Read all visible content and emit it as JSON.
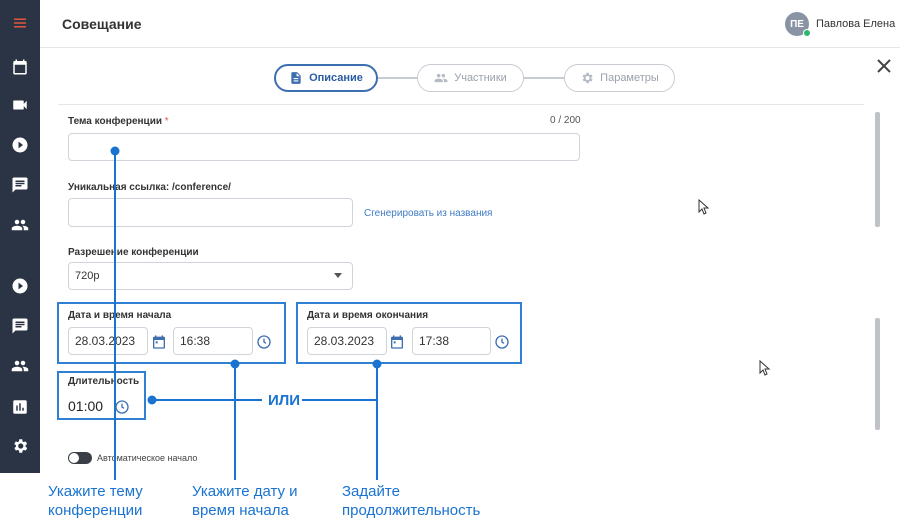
{
  "header": {
    "title": "Совещание",
    "user": {
      "initials": "ПЕ",
      "name": "Павлова Елена"
    }
  },
  "sidebar": {
    "items": [
      {
        "icon": "menu-icon"
      },
      {
        "icon": "calendar-icon"
      },
      {
        "icon": "video-camera-icon"
      },
      {
        "icon": "play-circle-icon"
      },
      {
        "icon": "chat-icon"
      },
      {
        "icon": "people-icon"
      },
      {
        "icon": "play-circle-icon"
      },
      {
        "icon": "chat-icon"
      },
      {
        "icon": "people-icon"
      },
      {
        "icon": "bar-chart-icon"
      },
      {
        "icon": "gear-icon"
      }
    ]
  },
  "stepper": {
    "steps": [
      {
        "label": "Описание",
        "icon": "document-icon",
        "active": true
      },
      {
        "label": "Участники",
        "icon": "people-icon",
        "active": false
      },
      {
        "label": "Параметры",
        "icon": "gear-icon",
        "active": false
      }
    ]
  },
  "form": {
    "topic_label": "Тема конференции",
    "required_mark": "*",
    "topic_counter": "0 / 200",
    "topic_value": "",
    "link_label": "Уникальная ссылка: /conference/",
    "link_value": "",
    "generate_link": "Сгенерировать из названия",
    "resolution_label": "Разрешение конференции",
    "resolution_value": "720p",
    "start_label": "Дата и время начала",
    "start_date": "28.03.2023",
    "start_time": "16:38",
    "end_label": "Дата и время окончания",
    "end_date": "28.03.2023",
    "end_time": "17:38",
    "duration_label": "Длительность",
    "duration_value": "01:00",
    "auto_start_label": "Автоматическое начало",
    "auto_start_on": true
  },
  "annotations": {
    "or_label": "ИЛИ",
    "topic_hint_1": "Укажите тему",
    "topic_hint_2": "конференции",
    "date_hint_1": "Укажите дату и",
    "date_hint_2": "время начала",
    "duration_hint_1": "Задайте",
    "duration_hint_2": "продолжительность"
  },
  "colors": {
    "sidebar_bg": "#2b3444",
    "accent": "#3d6fb0",
    "annotation_blue": "#1a73d1",
    "required": "#e2563d",
    "online_status": "#2fb86d"
  }
}
